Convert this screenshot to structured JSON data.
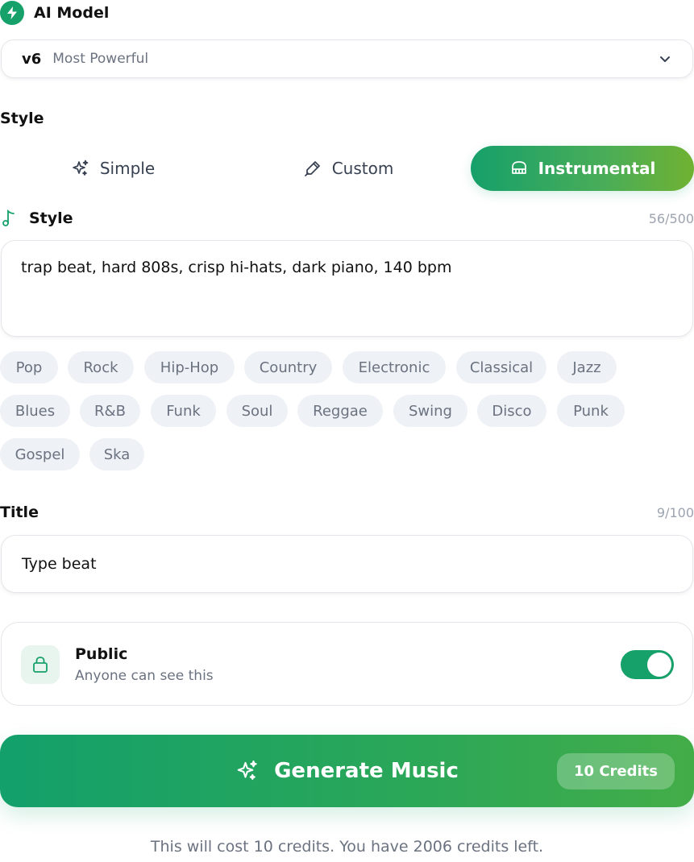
{
  "ai_model": {
    "header_label": "AI Model",
    "header_icon": "bolt-icon",
    "selected_version": "v6",
    "selected_description": "Most Powerful",
    "dropdown_icon": "chevron-down-icon"
  },
  "style_section": {
    "label": "Style",
    "tabs": [
      {
        "label": "Simple",
        "icon": "sparkles-icon",
        "active": false
      },
      {
        "label": "Custom",
        "icon": "pen-icon",
        "active": false
      },
      {
        "label": "Instrumental",
        "icon": "piano-icon",
        "active": true
      }
    ]
  },
  "style_input": {
    "label": "Style",
    "icon": "music-note-icon",
    "counter": "56/500",
    "value": "trap beat, hard 808s, crisp hi-hats, dark piano, 140 bpm"
  },
  "genre_chips": [
    "Pop",
    "Rock",
    "Hip-Hop",
    "Country",
    "Electronic",
    "Classical",
    "Jazz",
    "Blues",
    "R&B",
    "Funk",
    "Soul",
    "Reggae",
    "Swing",
    "Disco",
    "Punk",
    "Gospel",
    "Ska"
  ],
  "title_input": {
    "label": "Title",
    "counter": "9/100",
    "value": "Type beat"
  },
  "visibility": {
    "title": "Public",
    "subtitle": "Anyone can see this",
    "icon": "lock-icon",
    "enabled": true
  },
  "generate": {
    "label": "Generate Music",
    "icon": "sparkles-icon",
    "credits_badge": "10 Credits"
  },
  "cost_note": "This will cost 10 credits. You have 2006 credits left.",
  "colors": {
    "accent": "#16a06a",
    "accent_end": "#70b232",
    "chip_bg": "#eef1f5",
    "muted_text": "#6b7280"
  }
}
